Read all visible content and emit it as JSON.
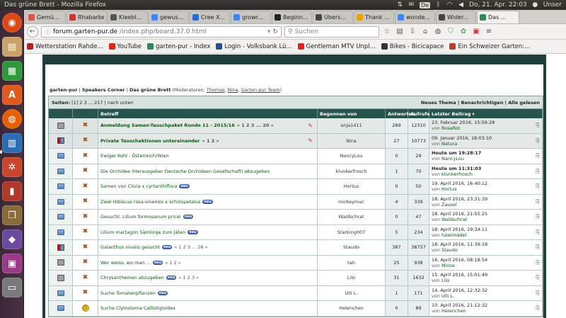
{
  "topbar": {
    "window_title": "Das grüne Brett - Mozilla Firefox",
    "keyboard": "De",
    "datetime": "Do, 21. Apr. 22:03",
    "user": "Unser"
  },
  "tabs": [
    {
      "label": "Gemü...",
      "color": "#d9534f"
    },
    {
      "label": "Rhabarber",
      "color": "#cc3333"
    },
    {
      "label": "Kleebl...",
      "color": "#555555"
    },
    {
      "label": "gewus...",
      "color": "#4285f4"
    },
    {
      "label": "Cree X...",
      "color": "#2a6bd1"
    },
    {
      "label": "growr...",
      "color": "#4285f4"
    },
    {
      "label": "Beginn...",
      "color": "#222222"
    },
    {
      "label": "Übers...",
      "color": "#444444"
    },
    {
      "label": "Thank ...",
      "color": "#e8a200"
    },
    {
      "label": "wonde...",
      "color": "#4285f4"
    },
    {
      "label": "Wider...",
      "color": "#444444"
    },
    {
      "label": "Das ...",
      "color": "#2e8b57",
      "active": true
    }
  ],
  "navbar": {
    "url_host": "forum.garten-pur.de",
    "url_path": "/index.php/board,37.0.html",
    "search_placeholder": "Suchen"
  },
  "bookmarks": [
    {
      "label": "Wetterstation Rahde...",
      "color": "#b22222"
    },
    {
      "label": "YouTube",
      "color": "#e62117"
    },
    {
      "label": "garten-pur - Index",
      "color": "#2e8b57"
    },
    {
      "label": "Login - Volksbank Lü...",
      "color": "#1f4fa0"
    },
    {
      "label": "Gentleman MTV Unpl...",
      "color": "#e62117"
    },
    {
      "label": "Bikes - Bicicapace",
      "color": "#333333"
    },
    {
      "label": "Ein Schweizer Garten:...",
      "color": "#c0392b"
    }
  ],
  "forum": {
    "breadcrumb_forum": "garten-pur",
    "breadcrumb_sep1": " | ",
    "breadcrumb_corner": "Speakers Corner",
    "breadcrumb_sep2": " | ",
    "breadcrumb_board": "Das grüne Brett",
    "moderators_prefix": " (Moderatoren: ",
    "mod1": "Thomas",
    "mod_sep1": ", ",
    "mod2": "Nina",
    "mod_sep2": ", ",
    "mod3": "Garten-pur Team",
    "moderators_suffix": ")",
    "pages_label": "Seiten:",
    "pages": " [1] 2 3 ... 217  |  nach unten",
    "actions": "Neues Thema | Benachrichtigen | Alle gelesen",
    "col_subject": "Betreff",
    "col_starter": "Begonnen von",
    "col_replies": "Antworten",
    "col_views": "Aufrufe",
    "col_last": "Letzter Beitrag"
  },
  "topics": [
    {
      "icon": "sticky",
      "subject": "Anmeldung Samen-Tauschpaket Runde 11 - 2015/16",
      "pages": "« 1 2 3 ... 20 »",
      "new": false,
      "pinned": true,
      "sticky": true,
      "starter": "anja1411",
      "replies": "289",
      "views": "12310",
      "last_date": "23. Februar 2016, 15:56:28",
      "last_by_prefix": "von ",
      "last_by": "RosaRot"
    },
    {
      "icon": "lock",
      "subject": "Private Tauschaktionen untereinander",
      "pages": "« 1 2 »",
      "new": false,
      "pinned": true,
      "sticky": true,
      "starter": "Nina",
      "replies": "27",
      "views": "10773",
      "last_date": "09. Januar 2016, 18:03:10",
      "last_by_prefix": "von ",
      "last_by": "Natura"
    },
    {
      "icon": "topic",
      "subject": "Ewiger Kohl - Österreich/Wien",
      "pages": "",
      "new": false,
      "starter": "NancyLou",
      "replies": "0",
      "views": "29",
      "last_date": "Heute um 19:28:17",
      "last_by_prefix": "von ",
      "last_by": "NancyLou"
    },
    {
      "icon": "topic",
      "subject": "Die Orchidee (Herausgeber Deutsche Orchideen Gesellschaft) abzugeben",
      "pages": "",
      "new": false,
      "starter": "klunkerfrosch",
      "replies": "1",
      "views": "70",
      "last_date": "Heute um 11:31:03",
      "last_by_prefix": "von ",
      "last_by": "klunkerfrosch"
    },
    {
      "icon": "topic",
      "subject": "Samen von Clivia x cyrtanthiflora",
      "pages": "",
      "new": true,
      "starter": "Hortus",
      "replies": "0",
      "views": "50",
      "last_date": "19. April 2016, 16:40:12",
      "last_by_prefix": "von ",
      "last_by": "Hortus"
    },
    {
      "icon": "topic",
      "subject": "Zwei Hibiscus rosa-sinensis x schizopetalus",
      "pages": "",
      "new": true,
      "starter": "mickeymuc",
      "replies": "4",
      "views": "339",
      "last_date": "18. April 2016, 23:31:39",
      "last_by_prefix": "von ",
      "last_by": "Zausel"
    },
    {
      "icon": "topic",
      "subject": "Gesucht: Lilium formosanum pricei",
      "pages": "",
      "new": true,
      "starter": "Waldschrat",
      "replies": "0",
      "views": "47",
      "last_date": "18. April 2016, 21:55:25",
      "last_by_prefix": "von ",
      "last_by": "Waldschrat"
    },
    {
      "icon": "topic",
      "subject": "Lilium martagon Sämlinge zum Jäten",
      "pages": "",
      "new": true,
      "starter": "Starking007",
      "replies": "5",
      "views": "234",
      "last_date": "18. April 2016, 19:34:11",
      "last_by_prefix": "von ",
      "last_by": "häwimädel"
    },
    {
      "icon": "lock",
      "subject": "Galanthus nivalis gesucht",
      "pages": "« 1 2 3 ... 26 »",
      "new": true,
      "starter": "Staudo",
      "replies": "387",
      "views": "38757",
      "last_date": "18. April 2016, 11:39:18",
      "last_by_prefix": "von ",
      "last_by": "Staudo"
    },
    {
      "icon": "sticky",
      "subject": "Wer weiss, wo man ...",
      "pages": "« 1 2 »",
      "new": true,
      "starter": "tati",
      "replies": "25",
      "views": "938",
      "last_date": "16. April 2016, 08:18:54",
      "last_by_prefix": "von ",
      "last_by": "Minze"
    },
    {
      "icon": "sticky",
      "subject": "Chrysanthemen abzugeben",
      "pages": "« 1 2 3 »",
      "new": true,
      "starter": "Lilo",
      "replies": "31",
      "views": "1632",
      "last_date": "15. April 2016, 15:01:49",
      "last_by_prefix": "von ",
      "last_by": "Lilo"
    },
    {
      "icon": "topic",
      "subject": "Suche Tomatenpflanzen",
      "pages": "",
      "new": true,
      "starter": "Ulli L.",
      "replies": "1",
      "views": "171",
      "last_date": "14. April 2016, 12:32:32",
      "last_by_prefix": "von ",
      "last_by": "Ulli L."
    },
    {
      "icon": "smile",
      "subject": "Suche Clytostoma Callistigioides",
      "pages": "",
      "new": false,
      "starter": "Helenchen",
      "replies": "0",
      "views": "89",
      "last_date": "10. April 2016, 21:12:32",
      "last_by_prefix": "von ",
      "last_by": "Helenchen"
    }
  ],
  "labels": {
    "new_badge": "neu"
  }
}
